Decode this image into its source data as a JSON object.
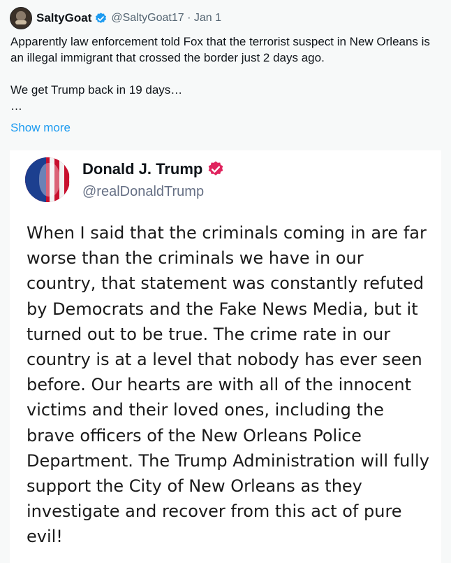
{
  "tweet": {
    "author_name": "SaltyGoat",
    "handle_and_date": "@SaltyGoat17 · Jan 1",
    "text": "Apparently law enforcement told Fox that the terrorist suspect in New Orleans is an illegal immigrant that crossed the border just 2 days ago.\n\nWe get Trump back in 19 days…\n…",
    "show_more": "Show more"
  },
  "embedded_post": {
    "author_name": "Donald J. Trump",
    "handle": "@realDonaldTrump",
    "text": "When I said that the criminals coming in are far worse than the criminals we have in our country, that statement was constantly refuted by Democrats and the Fake News Media, but it turned out to be true. The crime rate in our country is at a level that nobody has ever seen before. Our hearts are with all of the innocent victims and their loved ones, including the brave officers of the New Orleans Police Department. The Trump Administration will fully support the City of New Orleans as they investigate and recover from this act of pure evil!"
  },
  "colors": {
    "link": "#1d9bf0",
    "verified_blue": "#1d9bf0",
    "verified_red": "#e0245e",
    "background": "#f7f9f9"
  }
}
